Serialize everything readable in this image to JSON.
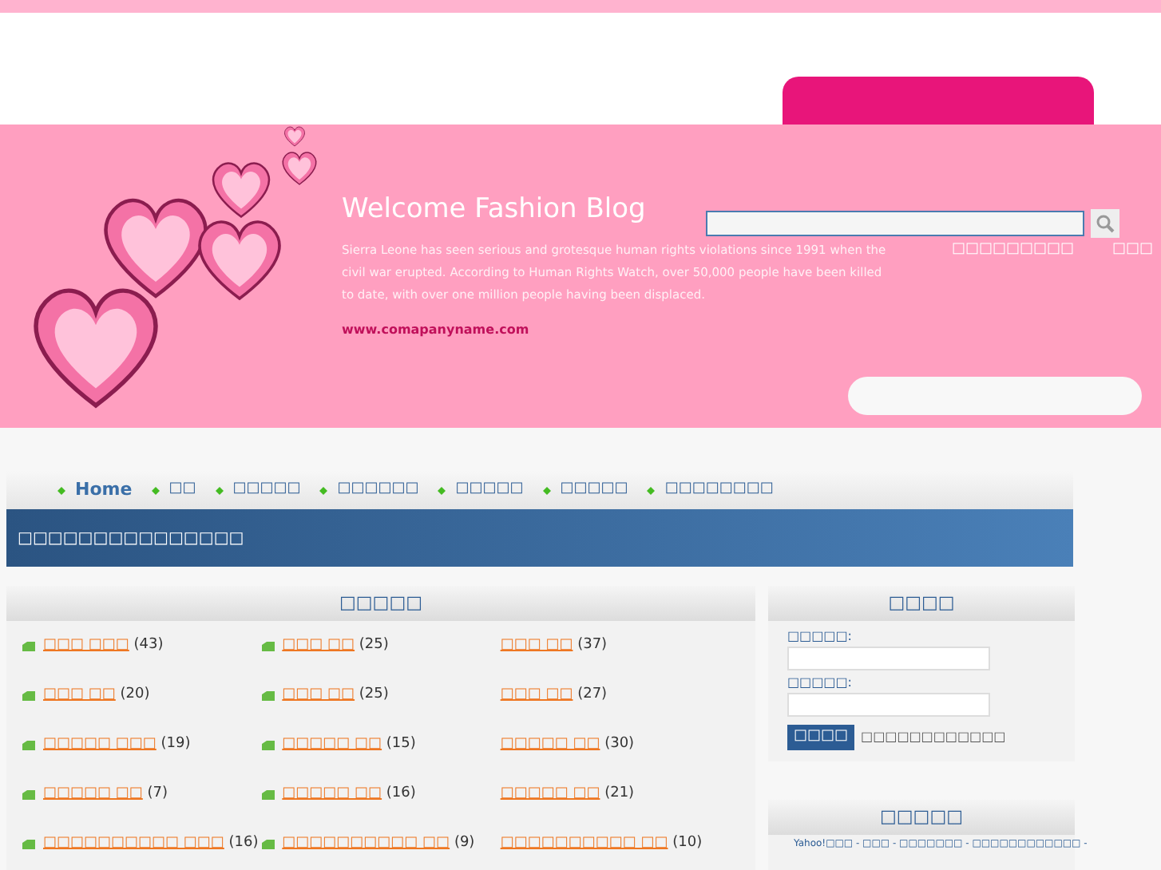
{
  "header": {
    "title": "Welcome Fashion Blog",
    "description": "Sierra Leone has seen serious and grotesque human rights violations since 1991 when the civil war erupted. According to Human Rights Watch, over 50,000 people have been killed to date, with over one million people having been displaced.",
    "link": "www.comapanyname.com"
  },
  "search": {
    "links": [
      "□□□□□□□□□",
      "□□□"
    ]
  },
  "nav": [
    {
      "label": "Home",
      "selected": true
    },
    {
      "label": "□□",
      "selected": false
    },
    {
      "label": "□□□□□",
      "selected": false
    },
    {
      "label": "□□□□□□",
      "selected": false
    },
    {
      "label": "□□□□□",
      "selected": false
    },
    {
      "label": "□□□□□",
      "selected": false
    },
    {
      "label": "□□□□□□□□",
      "selected": false
    }
  ],
  "banner": "□□□□□□□□□□□□□□□",
  "categories": {
    "title": "□□□□□",
    "items": [
      {
        "name": "□□□ □□□",
        "count": "(43)",
        "icon": true
      },
      {
        "name": "□□□ □□",
        "count": "(25)",
        "icon": true
      },
      {
        "name": "□□□ □□",
        "count": "(37)",
        "icon": false
      },
      {
        "name": "□□□ □□",
        "count": "(20)",
        "icon": true
      },
      {
        "name": "□□□ □□",
        "count": "(25)",
        "icon": true
      },
      {
        "name": "□□□ □□",
        "count": "(27)",
        "icon": false
      },
      {
        "name": "□□□□□ □□□",
        "count": "(19)",
        "icon": true
      },
      {
        "name": "□□□□□ □□",
        "count": "(15)",
        "icon": true
      },
      {
        "name": "□□□□□ □□",
        "count": "(30)",
        "icon": false
      },
      {
        "name": "□□□□□ □□",
        "count": "(7)",
        "icon": true
      },
      {
        "name": "□□□□□ □□",
        "count": "(16)",
        "icon": true
      },
      {
        "name": "□□□□□ □□",
        "count": "(21)",
        "icon": false
      },
      {
        "name": "□□□□□□□□□□ □□□",
        "count": "(16)",
        "icon": true
      },
      {
        "name": "□□□□□□□□□□ □□",
        "count": "(9)",
        "icon": true
      },
      {
        "name": "□□□□□□□□□□ □□",
        "count": "(10)",
        "icon": false
      }
    ]
  },
  "login": {
    "title": "□□□□",
    "fields": [
      {
        "label": "□□□□□:"
      },
      {
        "label": "□□□□□:"
      }
    ],
    "button": "□□□□",
    "link": "□□□□□□□□□□□□"
  },
  "links_box": {
    "title": "□□□□□",
    "items": [
      "Yahoo!□□□ - □□□ - □□□□□□□ - □□□□□□□□□□□□ -"
    ]
  }
}
